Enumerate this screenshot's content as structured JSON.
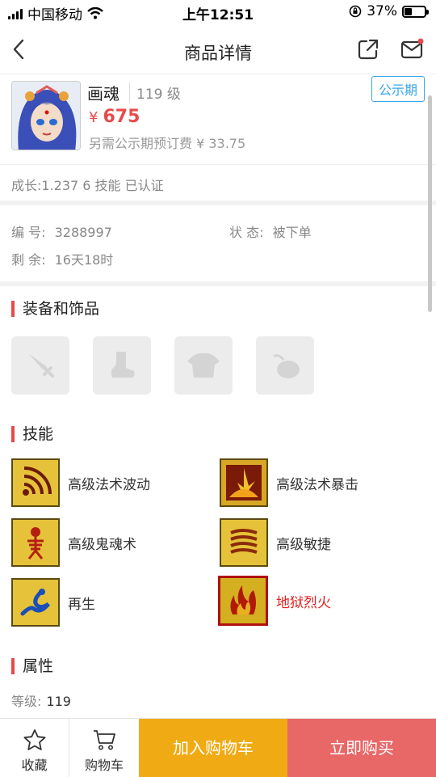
{
  "status_bar": {
    "carrier": "中国移动",
    "time": "上午12:51",
    "battery": "37%",
    "battery_level": 0.37
  },
  "nav": {
    "title": "商品详情"
  },
  "product": {
    "name": "画魂",
    "level": "119 级",
    "badge": "公示期",
    "price_currency": "¥",
    "price": "675",
    "fee": "另需公示期预订费 ¥ 33.75"
  },
  "growth": "成长:1.237 6 技能 已认证",
  "info": {
    "id_label": "编 号:",
    "id_value": "3288997",
    "state_label": "状 态:",
    "state_value": "被下单",
    "remain_label": "剩 余:",
    "remain_value": "16天18时"
  },
  "sections": {
    "equipment": "装备和饰品",
    "skills": "技能",
    "attributes": "属性"
  },
  "skills": [
    {
      "label": "高级法术波动",
      "icon": "wave-skill-icon"
    },
    {
      "label": "高级法术暴击",
      "icon": "burst-skill-icon"
    },
    {
      "label": "高级鬼魂术",
      "icon": "skeleton-skill-icon"
    },
    {
      "label": "高级敏捷",
      "icon": "agility-skill-icon"
    },
    {
      "label": "再生",
      "icon": "regen-skill-icon"
    },
    {
      "label": "地狱烈火",
      "icon": "fire-skill-icon"
    }
  ],
  "attributes": {
    "level_label": "等级:",
    "level_value": "119"
  },
  "bottom_bar": {
    "favorite": "收藏",
    "cart": "购物车",
    "add_to_cart": "加入购物车",
    "buy_now": "立即购买"
  },
  "colors": {
    "accent_red": "#e64b4b",
    "badge_blue": "#3aa6e8",
    "add_cart": "#f0aa14",
    "buy_now": "#e86767"
  }
}
